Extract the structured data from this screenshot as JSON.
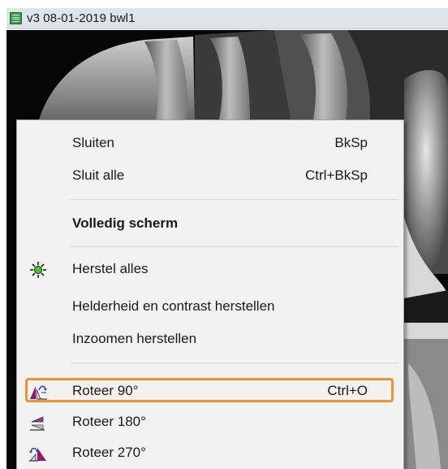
{
  "window": {
    "title": "v3  08-01-2019  bwl1",
    "app_icon": "list-document-icon"
  },
  "image": {
    "type": "dental-xray",
    "description_icon": "xray-image"
  },
  "context_menu": {
    "items": [
      {
        "label": "Sluiten",
        "shortcut": "BkSp"
      },
      {
        "label": "Sluit alle",
        "shortcut": "Ctrl+BkSp"
      },
      {
        "label": "Volledig scherm",
        "shortcut": ""
      },
      {
        "label": "Herstel alles",
        "shortcut": "",
        "icon": "green-sun-reset-icon"
      },
      {
        "label": "Helderheid en contrast herstellen",
        "shortcut": ""
      },
      {
        "label": "Inzoomen herstellen",
        "shortcut": ""
      },
      {
        "label": "Roteer 90°",
        "shortcut": "Ctrl+O",
        "icon": "rotate-90-icon",
        "highlighted": true
      },
      {
        "label": "Roteer 180°",
        "shortcut": "",
        "icon": "rotate-180-icon"
      },
      {
        "label": "Roteer 270°",
        "shortcut": "",
        "icon": "rotate-270-icon"
      }
    ]
  },
  "colors": {
    "highlight_border": "#f0932b",
    "menu_background": "#f2f2f2",
    "titlebar_background": "#dfe4ea",
    "sun_icon": "#3ecf1a"
  }
}
